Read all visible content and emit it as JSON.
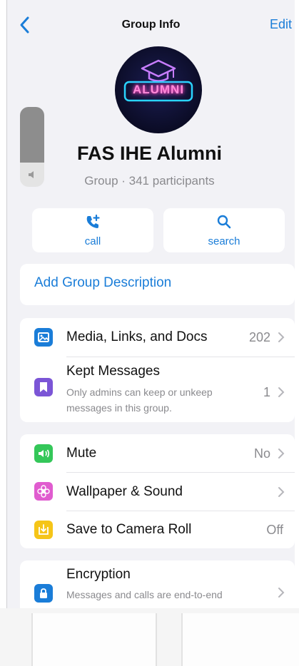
{
  "header": {
    "title": "Group Info",
    "edit_label": "Edit"
  },
  "avatar": {
    "neon_text": "ALUMNI"
  },
  "group": {
    "name": "FAS IHE Alumni",
    "subtitle": "Group · 341 participants"
  },
  "actions": [
    {
      "label": "call",
      "icon": "phone-plus-icon"
    },
    {
      "label": "search",
      "icon": "search-icon"
    }
  ],
  "description": {
    "link_label": "Add Group Description"
  },
  "section1": {
    "media": {
      "label": "Media, Links, and Docs",
      "value": "202",
      "icon_color": "#1a7dd8"
    },
    "kept": {
      "label": "Kept Messages",
      "sub": "Only admins can keep or unkeep messages in this group.",
      "value": "1",
      "icon_color": "#7b55d6"
    }
  },
  "section2": {
    "mute": {
      "label": "Mute",
      "value": "No",
      "icon_color": "#34c759"
    },
    "wallpaper": {
      "label": "Wallpaper & Sound",
      "icon_color": "#e05ccf"
    },
    "camera_roll": {
      "label": "Save to Camera Roll",
      "value": "Off",
      "icon_color": "#f5c518"
    }
  },
  "section3": {
    "encryption": {
      "label": "Encryption",
      "sub": "Messages and calls are end-to-end",
      "icon_color": "#1a7dd8"
    }
  },
  "colors": {
    "accent": "#1a7dd8",
    "background": "#f2f2f6"
  }
}
